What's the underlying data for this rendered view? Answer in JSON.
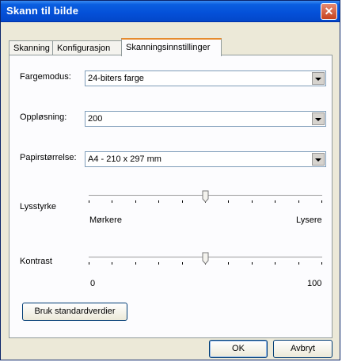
{
  "window": {
    "title": "Skann til bilde"
  },
  "tabs": [
    {
      "label": "Skanning"
    },
    {
      "label": "Konfigurasjon"
    },
    {
      "label": "Skanningsinnstillinger"
    }
  ],
  "settings": {
    "color_mode": {
      "label": "Fargemodus:",
      "value": "24-biters farge"
    },
    "resolution": {
      "label": "Oppløsning:",
      "value": "200"
    },
    "paper_size": {
      "label": "Papirstørrelse:",
      "value": "A4 - 210 x 297 mm"
    },
    "brightness": {
      "label": "Lysstyrke",
      "min_label": "Mørkere",
      "max_label": "Lysere",
      "level": 0.5
    },
    "contrast": {
      "label": "Kontrast",
      "min_label": "0",
      "max_label": "100",
      "level": 0.5
    }
  },
  "buttons": {
    "defaults": "Bruk standardverdier",
    "ok": "OK",
    "cancel": "Avbryt"
  }
}
